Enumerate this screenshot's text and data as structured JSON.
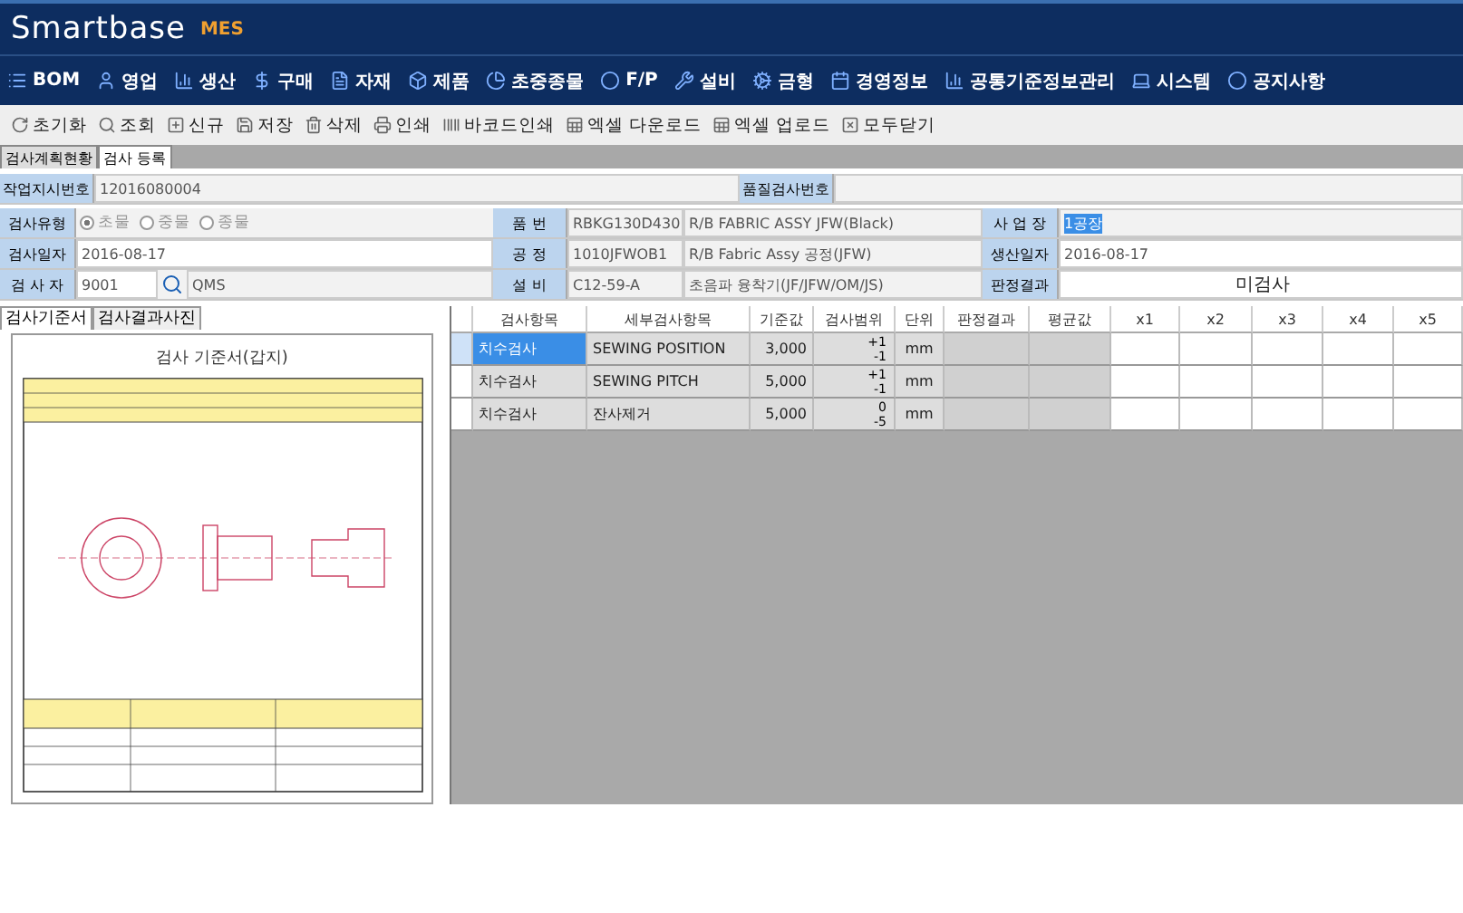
{
  "logo": {
    "brand": "Smartbase",
    "product": "MES"
  },
  "menu": [
    "BOM",
    "영업",
    "생산",
    "구매",
    "자재",
    "제품",
    "초중종물",
    "F/P",
    "설비",
    "금형",
    "경영정보",
    "공통기준정보관리",
    "시스템",
    "공지사항"
  ],
  "toolbar": [
    "초기화",
    "조회",
    "신규",
    "저장",
    "삭제",
    "인쇄",
    "바코드인쇄",
    "엑셀 다운로드",
    "엑셀 업로드",
    "모두닫기"
  ],
  "tabs": [
    {
      "label": "검사계획현황",
      "selected": false
    },
    {
      "label": "검사 등록",
      "selected": true
    }
  ],
  "header": {
    "work_order_label": "작업지시번호",
    "work_order": "12016080004",
    "quality_no_label": "품질검사번호"
  },
  "form": {
    "type_label": "검사유형",
    "types": [
      {
        "label": "초물",
        "selected": true
      },
      {
        "label": "중물",
        "selected": false
      },
      {
        "label": "종물",
        "selected": false
      }
    ],
    "date_label": "검사일자",
    "date": "2016-08-17",
    "inspector_label": "검 사 자",
    "inspector_id": "9001",
    "inspector_name": "QMS",
    "part_label": "품 번",
    "part_code": "RBKG130D430",
    "part_name": "R/B FABRIC ASSY JFW(Black)",
    "process_label": "공 정",
    "process_code": "1010JFWOB1",
    "process_name": "R/B Fabric Assy 공정(JFW)",
    "equipment_label": "설 비",
    "equipment_code": "C12-59-A",
    "equipment_name": "초음파 융착기(JF/JFW/OM/JS)",
    "site_label": "사 업 장",
    "site": "1공장",
    "prod_date_label": "생산일자",
    "prod_date": "2016-08-17",
    "judgement_label": "판정결과",
    "judgement": "미검사"
  },
  "doc_tabs": [
    {
      "label": "검사기준서",
      "selected": true
    },
    {
      "label": "검사결과사진",
      "selected": false
    }
  ],
  "document": {
    "title": "검사 기준서(갑지)"
  },
  "table": {
    "columns": [
      "검사항목",
      "세부검사항목",
      "기준값",
      "검사범위",
      "단위",
      "판정결과",
      "평균값",
      "x1",
      "x2",
      "x3",
      "x4",
      "x5"
    ],
    "rows": [
      {
        "item": "치수검사",
        "detail": "SEWING POSITION",
        "standard": "3,000",
        "upper": "+1",
        "lower": "-1",
        "unit": "mm",
        "selected": true
      },
      {
        "item": "치수검사",
        "detail": "SEWING PITCH",
        "standard": "5,000",
        "upper": "+1",
        "lower": "-1",
        "unit": "mm",
        "selected": false
      },
      {
        "item": "치수검사",
        "detail": "잔사제거",
        "standard": "5,000",
        "upper": "0",
        "lower": "-5",
        "unit": "mm",
        "selected": false
      }
    ]
  }
}
